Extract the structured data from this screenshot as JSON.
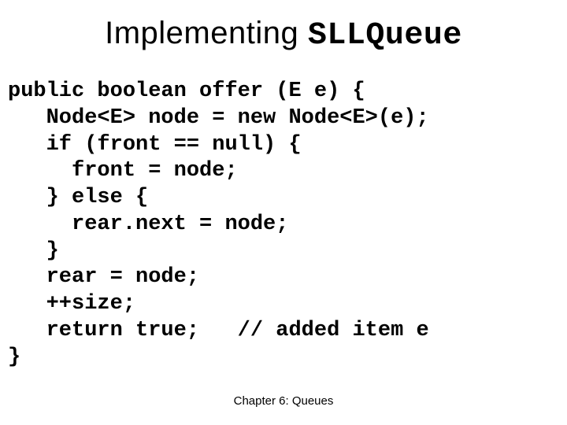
{
  "title": {
    "prefix": "Implementing ",
    "mono": "SLLQueue"
  },
  "code": "public boolean offer (E e) {\n   Node<E> node = new Node<E>(e);\n   if (front == null) {\n     front = node;\n   } else {\n     rear.next = node;\n   }\n   rear = node;\n   ++size;\n   return true;   // added item e\n}",
  "footer": "Chapter 6: Queues"
}
